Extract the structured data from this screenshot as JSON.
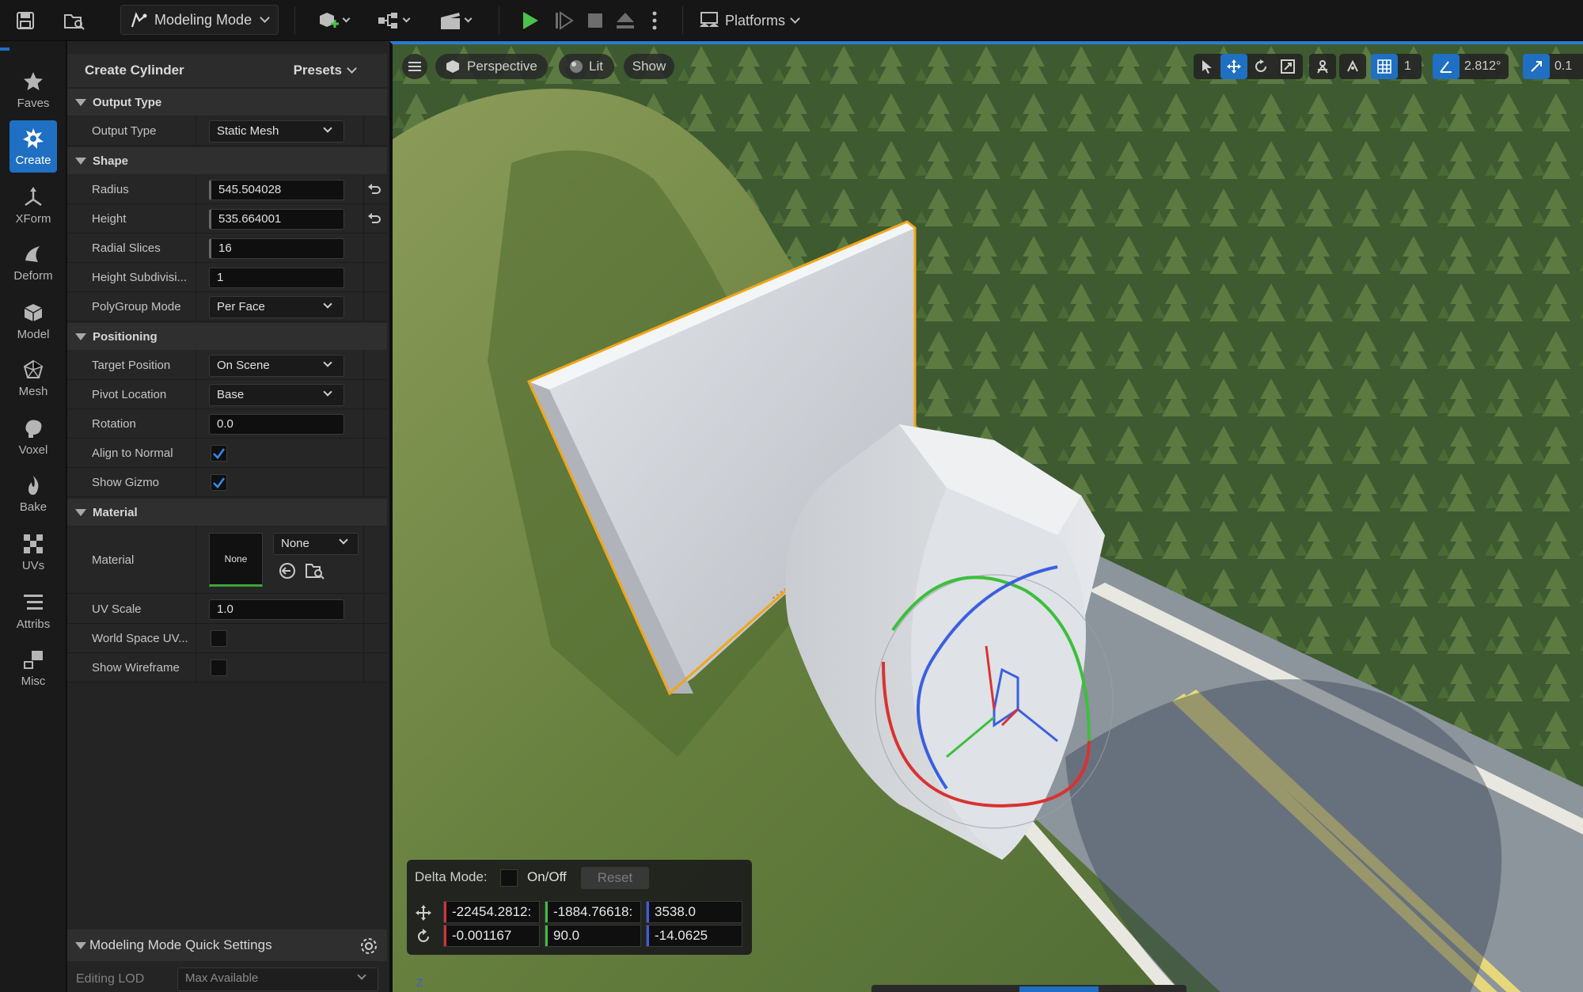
{
  "toolbar": {
    "mode_label": "Modeling Mode",
    "platforms_label": "Platforms"
  },
  "categories": [
    {
      "label": "Faves",
      "icon": "star-icon"
    },
    {
      "label": "Create",
      "icon": "create-icon"
    },
    {
      "label": "XForm",
      "icon": "xform-icon"
    },
    {
      "label": "Deform",
      "icon": "deform-icon"
    },
    {
      "label": "Model",
      "icon": "model-icon"
    },
    {
      "label": "Mesh",
      "icon": "mesh-icon"
    },
    {
      "label": "Voxel",
      "icon": "voxel-icon"
    },
    {
      "label": "Bake",
      "icon": "bake-icon"
    },
    {
      "label": "UVs",
      "icon": "uvs-icon"
    },
    {
      "label": "Attribs",
      "icon": "attribs-icon"
    },
    {
      "label": "Misc",
      "icon": "misc-icon"
    }
  ],
  "panel": {
    "title": "Create Cylinder",
    "presets": "Presets",
    "sections": {
      "output_type": "Output Type",
      "shape": "Shape",
      "positioning": "Positioning",
      "material": "Material"
    },
    "output_type": {
      "label": "Output Type",
      "value": "Static Mesh"
    },
    "radius": {
      "label": "Radius",
      "value": "545.504028"
    },
    "height": {
      "label": "Height",
      "value": "535.664001"
    },
    "radial_slices": {
      "label": "Radial Slices",
      "value": "16"
    },
    "height_subdiv": {
      "label": "Height Subdivisi...",
      "value": "1"
    },
    "polygroup_mode": {
      "label": "PolyGroup Mode",
      "value": "Per Face"
    },
    "target_position": {
      "label": "Target Position",
      "value": "On Scene"
    },
    "pivot_location": {
      "label": "Pivot Location",
      "value": "Base"
    },
    "rotation": {
      "label": "Rotation",
      "value": "0.0"
    },
    "align_to_normal": {
      "label": "Align to Normal",
      "checked": true
    },
    "show_gizmo": {
      "label": "Show Gizmo",
      "checked": true
    },
    "material": {
      "label": "Material",
      "thumb": "None",
      "value": "None"
    },
    "uv_scale": {
      "label": "UV Scale",
      "value": "1.0"
    },
    "world_space_uv": {
      "label": "World Space UV...",
      "checked": false
    },
    "show_wireframe": {
      "label": "Show Wireframe",
      "checked": false
    },
    "quick_settings": "Modeling Mode Quick Settings",
    "editing_lod": {
      "label": "Editing LOD",
      "value": "Max Available"
    }
  },
  "viewport": {
    "perspective": "Perspective",
    "lit": "Lit",
    "show": "Show",
    "grid_value": "1",
    "angle_value": "2.812°",
    "scale_value": "0.1",
    "delta_mode": "Delta Mode:",
    "onoff": "On/Off",
    "reset": "Reset",
    "translate": [
      "-22454.2812:",
      "-1884.76618:",
      "3538.0"
    ],
    "rotate": [
      "-0.001167",
      "90.0",
      "-14.0625"
    ]
  },
  "colors": {
    "accent": "#1f6fc2",
    "play_green": "#4cc24c",
    "x_axis": "#d93232",
    "y_axis": "#3cbf3c",
    "z_axis": "#3a5fe0",
    "selection_orange": "#f2a51a"
  }
}
